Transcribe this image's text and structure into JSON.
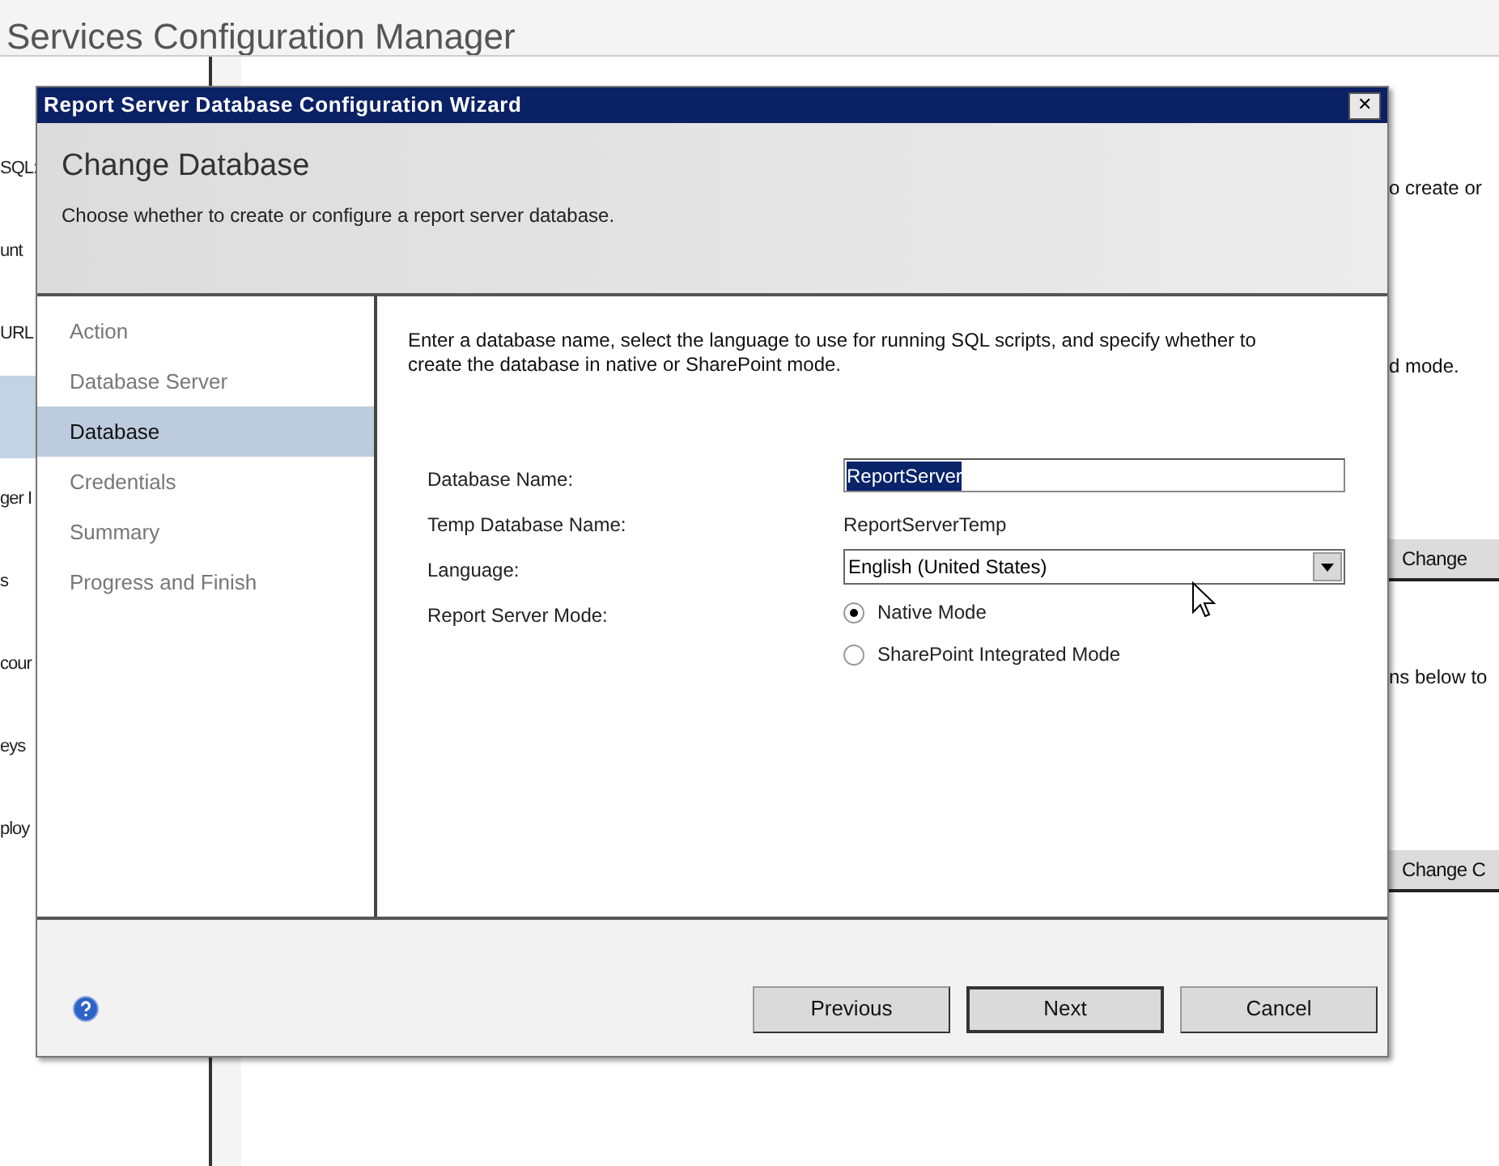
{
  "background_window": {
    "title": "Services Configuration Manager",
    "nav_fragments": [
      {
        "label": "SQL:",
        "selected": false
      },
      {
        "label": "unt",
        "selected": false
      },
      {
        "label": "URL",
        "selected": false
      },
      {
        "selected": true
      },
      {
        "label": "ger I",
        "selected": false
      },
      {
        "label": "s",
        "selected": false
      },
      {
        "label": "cour",
        "selected": false
      },
      {
        "label": "eys",
        "selected": false
      },
      {
        "label": "ploy",
        "selected": false
      }
    ],
    "content_fragments": [
      {
        "kind": "text",
        "label": "o create or"
      },
      {
        "kind": "text",
        "label": "d mode."
      },
      {
        "kind": "button",
        "label": "Change"
      },
      {
        "kind": "text",
        "label": "ns below to"
      },
      {
        "kind": "button",
        "label": "Change C"
      }
    ]
  },
  "dialog": {
    "title": "Report Server Database Configuration Wizard",
    "close": "✕",
    "heading": "Change Database",
    "subheading": "Choose whether to create or configure a report server database.",
    "steps": [
      {
        "label": "Action",
        "selected": false
      },
      {
        "label": "Database Server",
        "selected": false
      },
      {
        "label": "Database",
        "selected": true
      },
      {
        "label": "Credentials",
        "selected": false
      },
      {
        "label": "Summary",
        "selected": false
      },
      {
        "label": "Progress and Finish",
        "selected": false
      }
    ],
    "instructions": "Enter a database name, select the language to use for running SQL scripts, and specify whether to create the database in native or SharePoint mode.",
    "fields": [
      {
        "kind": "text",
        "label": "Database Name:",
        "value": "ReportServer",
        "text_selected": true
      },
      {
        "kind": "readonly",
        "label": "Temp Database Name:",
        "value": "ReportServerTemp"
      },
      {
        "kind": "dropdown",
        "label": "Language:",
        "value": "English (United States)"
      },
      {
        "kind": "radio",
        "label": "Report Server Mode:",
        "options": [
          {
            "label": "Native Mode",
            "selected": true
          },
          {
            "label": "SharePoint Integrated Mode",
            "selected": false
          }
        ]
      }
    ],
    "buttons": [
      {
        "label": "Previous",
        "default": false
      },
      {
        "label": "Next",
        "default": true
      },
      {
        "label": "Cancel",
        "default": false
      }
    ]
  }
}
